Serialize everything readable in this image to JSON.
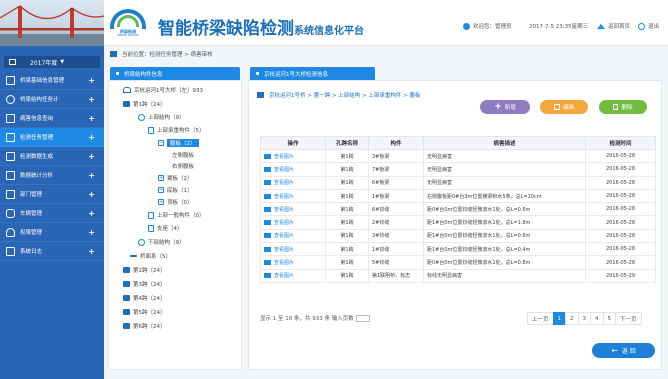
{
  "header": {
    "logo_text": "桥梁检测",
    "logo_sub": "BRIDGE WISDOM",
    "title_main": "智能桥梁缺陷检测",
    "title_sub": "系统信息化平台",
    "welcome": "欢迎您：管理员",
    "datetime": "2017-7-5  23:35星期三",
    "home_label": "返回首页",
    "exit_label": "退出"
  },
  "sidebar": {
    "year": "2017年度",
    "items": [
      {
        "label": "桥梁基础信息管理"
      },
      {
        "label": "桥梁结构任务计"
      },
      {
        "label": "病害信息查询"
      },
      {
        "label": "检测任务管理"
      },
      {
        "label": "检测数据生成"
      },
      {
        "label": "数据统计分析"
      },
      {
        "label": "部门管理"
      },
      {
        "label": "车辆管理"
      },
      {
        "label": "权限管理"
      },
      {
        "label": "系统日志"
      }
    ]
  },
  "breadcrumb": "当前位置：检测任务管理 > 病害审核",
  "left_panel": {
    "tab": "桥梁结构件信息",
    "tree": [
      {
        "label": "京杭运河1号大桥（左）933"
      },
      {
        "label": "第1跨（24）"
      },
      {
        "label": "上部结构（9）"
      },
      {
        "label": "上部承重构件（5）"
      },
      {
        "label": "腹板（2）"
      },
      {
        "label": "左侧腹板"
      },
      {
        "label": "右侧腹板"
      },
      {
        "label": "翼板（2）"
      },
      {
        "label": "底板（1）"
      },
      {
        "label": "顶板（0）"
      },
      {
        "label": "上部一般构件（0）"
      },
      {
        "label": "支座（4）"
      },
      {
        "label": "下部结构（9）"
      },
      {
        "label": "桥面系（5）"
      },
      {
        "label": "第2跨（24）"
      },
      {
        "label": "第3跨（24）"
      },
      {
        "label": "第4跨（24）"
      },
      {
        "label": "第5跨（24）"
      },
      {
        "label": "第6跨（24）"
      }
    ]
  },
  "right_panel": {
    "tab": "京杭运河1号大桥检测信息",
    "path": "京杭运河1号桥 > 第一跨 > 上部结构 > 上部承重构件 > 腹板",
    "btn_add": "新增",
    "btn_edit": "编辑",
    "btn_delete": "删除",
    "columns": [
      "操作",
      "孔跨名称",
      "构件",
      "病害描述",
      "检测时间"
    ],
    "rows": [
      [
        "查看图片",
        "第1跨",
        "3#板梁",
        "无明显病害",
        "2016-05-28"
      ],
      [
        "查看图片",
        "第1跨",
        "7#板梁",
        "无明显病害",
        "2016-05-28"
      ],
      [
        "查看图片",
        "第1跨",
        "6#板梁",
        "无明显病害",
        "2016-05-28"
      ],
      [
        "查看图片",
        "第1跨",
        "1#板梁",
        "右侧腹板距0#台3m位置横梁积水5条，总L=10cm",
        "2016-05-28"
      ],
      [
        "查看图片",
        "第1跨",
        "6#铰缝",
        "距0#台0m位置铰缝轻微渗水1处，总L=0.6m",
        "2016-05-28"
      ],
      [
        "查看图片",
        "第1跨",
        "2#铰缝",
        "距1#台0m位置铰缝轻微渗水1处，总L=1.8m",
        "2016-05-28"
      ],
      [
        "查看图片",
        "第1跨",
        "3#铰缝",
        "距1#台0m位置铰缝轻微渗水1处，总L=0.6m",
        "2016-05-28"
      ],
      [
        "查看图片",
        "第1跨",
        "1#铰缝",
        "距1#台0m位置铰缝轻微渗水1处，总L=0.4m",
        "2016-05-28"
      ],
      [
        "查看图片",
        "第1跨",
        "5#铰缝",
        "距0#台0m位置铰缝轻微渗水1处，总L=0.8m",
        "2016-05-28"
      ],
      [
        "查看图片",
        "第1跨",
        "第1联明桥、标志",
        "标线无明显病害",
        "2016-05-29"
      ]
    ],
    "summary": "显示 1 至 10 条，共 933 条 输入页数",
    "pager": [
      "上一页",
      "1",
      "2",
      "3",
      "4",
      "5",
      "下一页"
    ],
    "back": "返 回"
  }
}
